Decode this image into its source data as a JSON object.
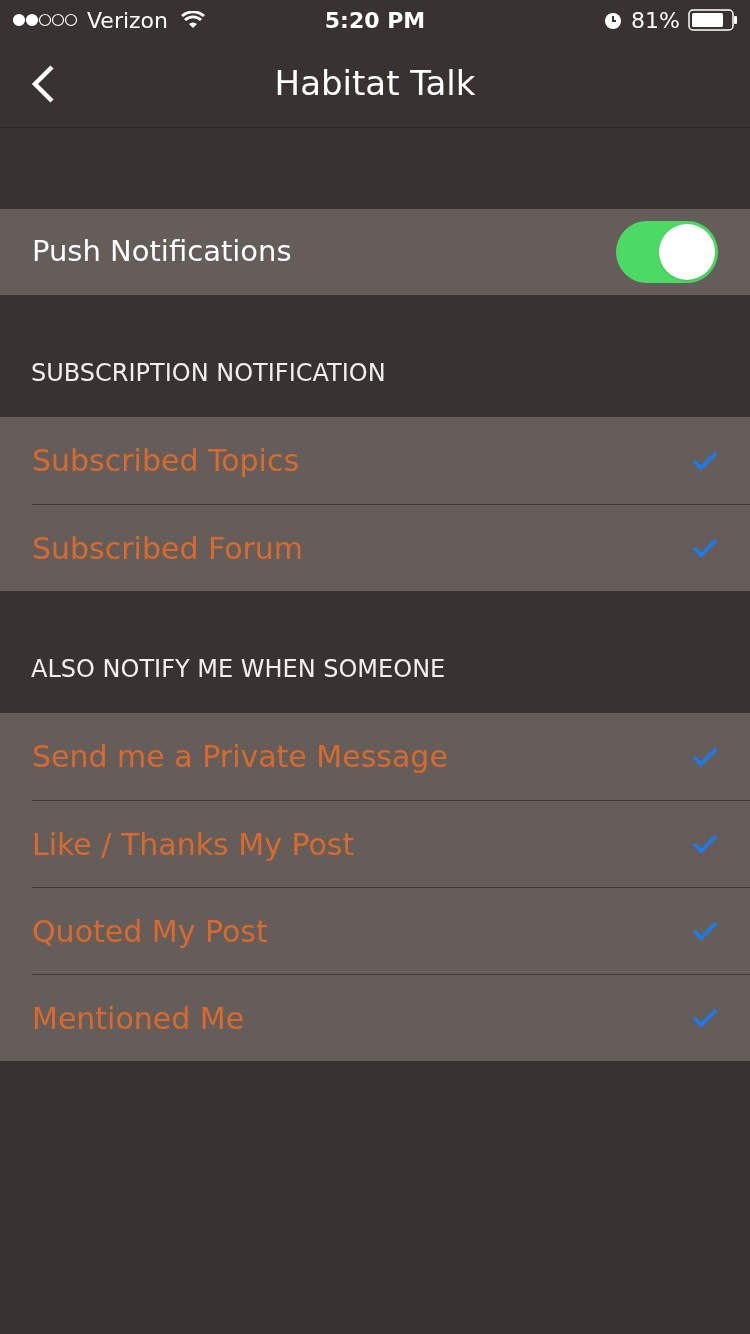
{
  "status_bar": {
    "carrier": "Verizon",
    "time": "5:20 PM",
    "battery": "81%"
  },
  "nav": {
    "title": "Habitat Talk"
  },
  "push": {
    "label": "Push Notifications",
    "on": true
  },
  "sections": [
    {
      "header": "SUBSCRIPTION NOTIFICATION",
      "items": [
        {
          "label": "Subscribed Topics",
          "checked": true
        },
        {
          "label": "Subscribed Forum",
          "checked": true
        }
      ]
    },
    {
      "header": "ALSO NOTIFY ME WHEN SOMEONE",
      "items": [
        {
          "label": "Send me a Private Message",
          "checked": true
        },
        {
          "label": "Like / Thanks My Post",
          "checked": true
        },
        {
          "label": "Quoted My Post",
          "checked": true
        },
        {
          "label": "Mentioned Me",
          "checked": true
        }
      ]
    }
  ]
}
